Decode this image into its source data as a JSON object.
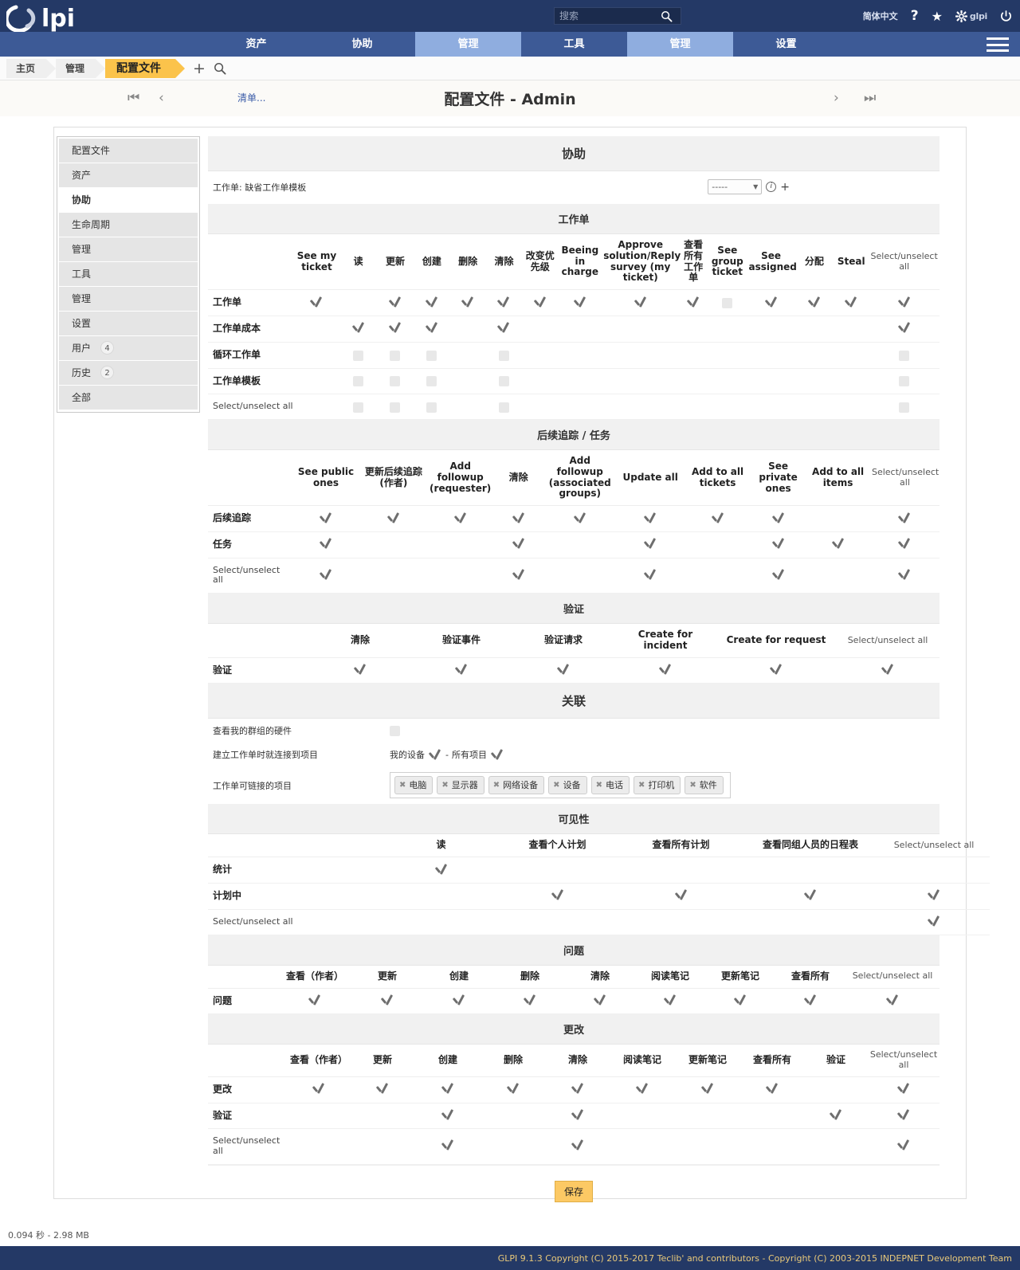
{
  "header": {
    "logo_text": "glpi",
    "search_placeholder": "搜索",
    "search_value": "",
    "language": "简体中文",
    "help_icon": "?",
    "star_icon": "★",
    "gear_label": "glpi",
    "power_icon": "⏻"
  },
  "menu": {
    "items": [
      {
        "label": "资产",
        "active": false
      },
      {
        "label": "协助",
        "active": false
      },
      {
        "label": "管理",
        "active": true
      },
      {
        "label": "工具",
        "active": false
      },
      {
        "label": "管理",
        "active": true
      },
      {
        "label": "设置",
        "active": false
      }
    ]
  },
  "breadcrumb": {
    "items": [
      "主页",
      "管理",
      "配置文件"
    ],
    "add_icon": "+",
    "search_icon": "search-icon"
  },
  "title_strip": {
    "list_link": "清单...",
    "page_title": "配置文件 - Admin"
  },
  "sidebar": {
    "items": [
      {
        "label": "配置文件",
        "selected": false,
        "badge": null
      },
      {
        "label": "资产",
        "selected": false,
        "badge": null
      },
      {
        "label": "协助",
        "selected": true,
        "badge": null
      },
      {
        "label": "生命周期",
        "selected": false,
        "badge": null
      },
      {
        "label": "管理",
        "selected": false,
        "badge": null
      },
      {
        "label": "工具",
        "selected": false,
        "badge": null
      },
      {
        "label": "管理",
        "selected": false,
        "badge": null
      },
      {
        "label": "设置",
        "selected": false,
        "badge": null
      },
      {
        "label": "用户",
        "selected": false,
        "badge": "4"
      },
      {
        "label": "历史",
        "selected": false,
        "badge": "2"
      },
      {
        "label": "全部",
        "selected": false,
        "badge": null
      }
    ]
  },
  "helpdesk": {
    "section_title": "协助",
    "template_label": "工作单: 缺省工作单模板",
    "template_value": "-----",
    "info_icon": "i",
    "add_icon": "+"
  },
  "ticket_table": {
    "title": "工作单",
    "columns": [
      "See my ticket",
      "读",
      "更新",
      "创建",
      "删除",
      "清除",
      "改变优先级",
      "Beeing in charge",
      "Approve solution/Reply survey (my ticket)",
      "查看所有工作单",
      "See group ticket",
      "See assigned",
      "分配",
      "Steal",
      "Select/unselect all"
    ],
    "rows": [
      {
        "label": "工作单",
        "bold": true,
        "cells": [
          "check",
          "",
          "check",
          "check",
          "check",
          "check",
          "check",
          "check",
          "check",
          "check",
          "box",
          "check",
          "check",
          "check",
          "check"
        ]
      },
      {
        "label": "工作单成本",
        "bold": true,
        "cells": [
          "",
          "check",
          "check",
          "check",
          "",
          "check",
          "",
          "",
          "",
          "",
          "",
          "",
          "",
          "",
          "check"
        ]
      },
      {
        "label": "循环工作单",
        "bold": true,
        "cells": [
          "",
          "box",
          "box",
          "box",
          "",
          "box",
          "",
          "",
          "",
          "",
          "",
          "",
          "",
          "",
          "box"
        ]
      },
      {
        "label": "工作单模板",
        "bold": true,
        "cells": [
          "",
          "box",
          "box",
          "box",
          "",
          "box",
          "",
          "",
          "",
          "",
          "",
          "",
          "",
          "",
          "box"
        ]
      },
      {
        "label": "Select/unselect all",
        "bold": false,
        "cells": [
          "",
          "box",
          "box",
          "box",
          "",
          "box",
          "",
          "",
          "",
          "",
          "",
          "",
          "",
          "",
          "box"
        ]
      }
    ]
  },
  "followup_table": {
    "title": "后续追踪 / 任务",
    "columns": [
      "See public ones",
      "更新后续追踪(作者)",
      "Add followup (requester)",
      "清除",
      "Add followup (associated groups)",
      "Update all",
      "Add to all tickets",
      "See private ones",
      "Add to all items",
      "Select/unselect all"
    ],
    "rows": [
      {
        "label": "后续追踪",
        "bold": true,
        "cells": [
          "check",
          "check",
          "check",
          "check",
          "check",
          "check",
          "check",
          "check",
          "",
          "check"
        ]
      },
      {
        "label": "任务",
        "bold": true,
        "cells": [
          "check",
          "",
          "",
          "check",
          "",
          "check",
          "",
          "check",
          "check",
          "check"
        ]
      },
      {
        "label": "Select/unselect all",
        "bold": false,
        "cells": [
          "check",
          "",
          "",
          "check",
          "",
          "check",
          "",
          "check",
          "",
          "check"
        ]
      }
    ]
  },
  "validation_table": {
    "title": "验证",
    "columns": [
      "清除",
      "验证事件",
      "验证请求",
      "Create for incident",
      "Create for request",
      "Select/unselect all"
    ],
    "rows": [
      {
        "label": "验证",
        "bold": true,
        "cells": [
          "check",
          "check",
          "check",
          "check",
          "check",
          "check"
        ]
      }
    ]
  },
  "association": {
    "title": "关联",
    "group_hw_label": "查看我的群组的硬件",
    "group_hw_value": "box",
    "link_label": "建立工作单时就连接到项目",
    "link_opt1": "我的设备",
    "link_sep": "-",
    "link_opt2": "所有项目",
    "items_label": "工作单可链接的项目",
    "tags": [
      "电脑",
      "显示器",
      "网络设备",
      "设备",
      "电话",
      "打印机",
      "软件"
    ]
  },
  "visibility_table": {
    "title": "可见性",
    "columns": [
      "读",
      "查看个人计划",
      "查看所有计划",
      "查看同组人员的日程表",
      "Select/unselect all"
    ],
    "rows": [
      {
        "label": "统计",
        "bold": true,
        "cells": [
          "check",
          "",
          "",
          "",
          ""
        ]
      },
      {
        "label": "计划中",
        "bold": true,
        "cells": [
          "",
          "check",
          "check",
          "check",
          "check"
        ]
      },
      {
        "label": "Select/unselect all",
        "bold": false,
        "cells": [
          "",
          "",
          "",
          "",
          "check"
        ]
      }
    ]
  },
  "problem_table": {
    "title": "问题",
    "columns": [
      "查看（作者）",
      "更新",
      "创建",
      "删除",
      "清除",
      "阅读笔记",
      "更新笔记",
      "查看所有",
      "Select/unselect all"
    ],
    "rows": [
      {
        "label": "问题",
        "bold": true,
        "cells": [
          "check",
          "check",
          "check",
          "check",
          "check",
          "check",
          "check",
          "check",
          "check"
        ]
      }
    ]
  },
  "change_table": {
    "title": "更改",
    "columns": [
      "查看（作者）",
      "更新",
      "创建",
      "删除",
      "清除",
      "阅读笔记",
      "更新笔记",
      "查看所有",
      "验证",
      "Select/unselect all"
    ],
    "rows": [
      {
        "label": "更改",
        "bold": true,
        "cells": [
          "check",
          "check",
          "check",
          "check",
          "check",
          "check",
          "check",
          "check",
          "",
          "check"
        ]
      },
      {
        "label": "验证",
        "bold": true,
        "cells": [
          "",
          "",
          "check",
          "",
          "check",
          "",
          "",
          "",
          "check",
          "check"
        ]
      },
      {
        "label": "Select/unselect all",
        "bold": false,
        "cells": [
          "",
          "",
          "check",
          "",
          "check",
          "",
          "",
          "",
          "",
          "check"
        ]
      }
    ]
  },
  "save_button": "保存",
  "footer": {
    "stats": "0.094 秒 - 2.98 MB",
    "copyright": "GLPI 9.1.3 Copyright (C) 2015-2017 Teclib' and contributors - Copyright (C) 2003-2015 INDEPNET Development Team"
  },
  "colors": {
    "header_bg": "#243966",
    "menu_bg": "#3d5a96",
    "menu_active": "#8faddf",
    "crumb_current": "#fbc34b",
    "save_bg": "#fcc964",
    "footer_text": "#e9c97a"
  }
}
